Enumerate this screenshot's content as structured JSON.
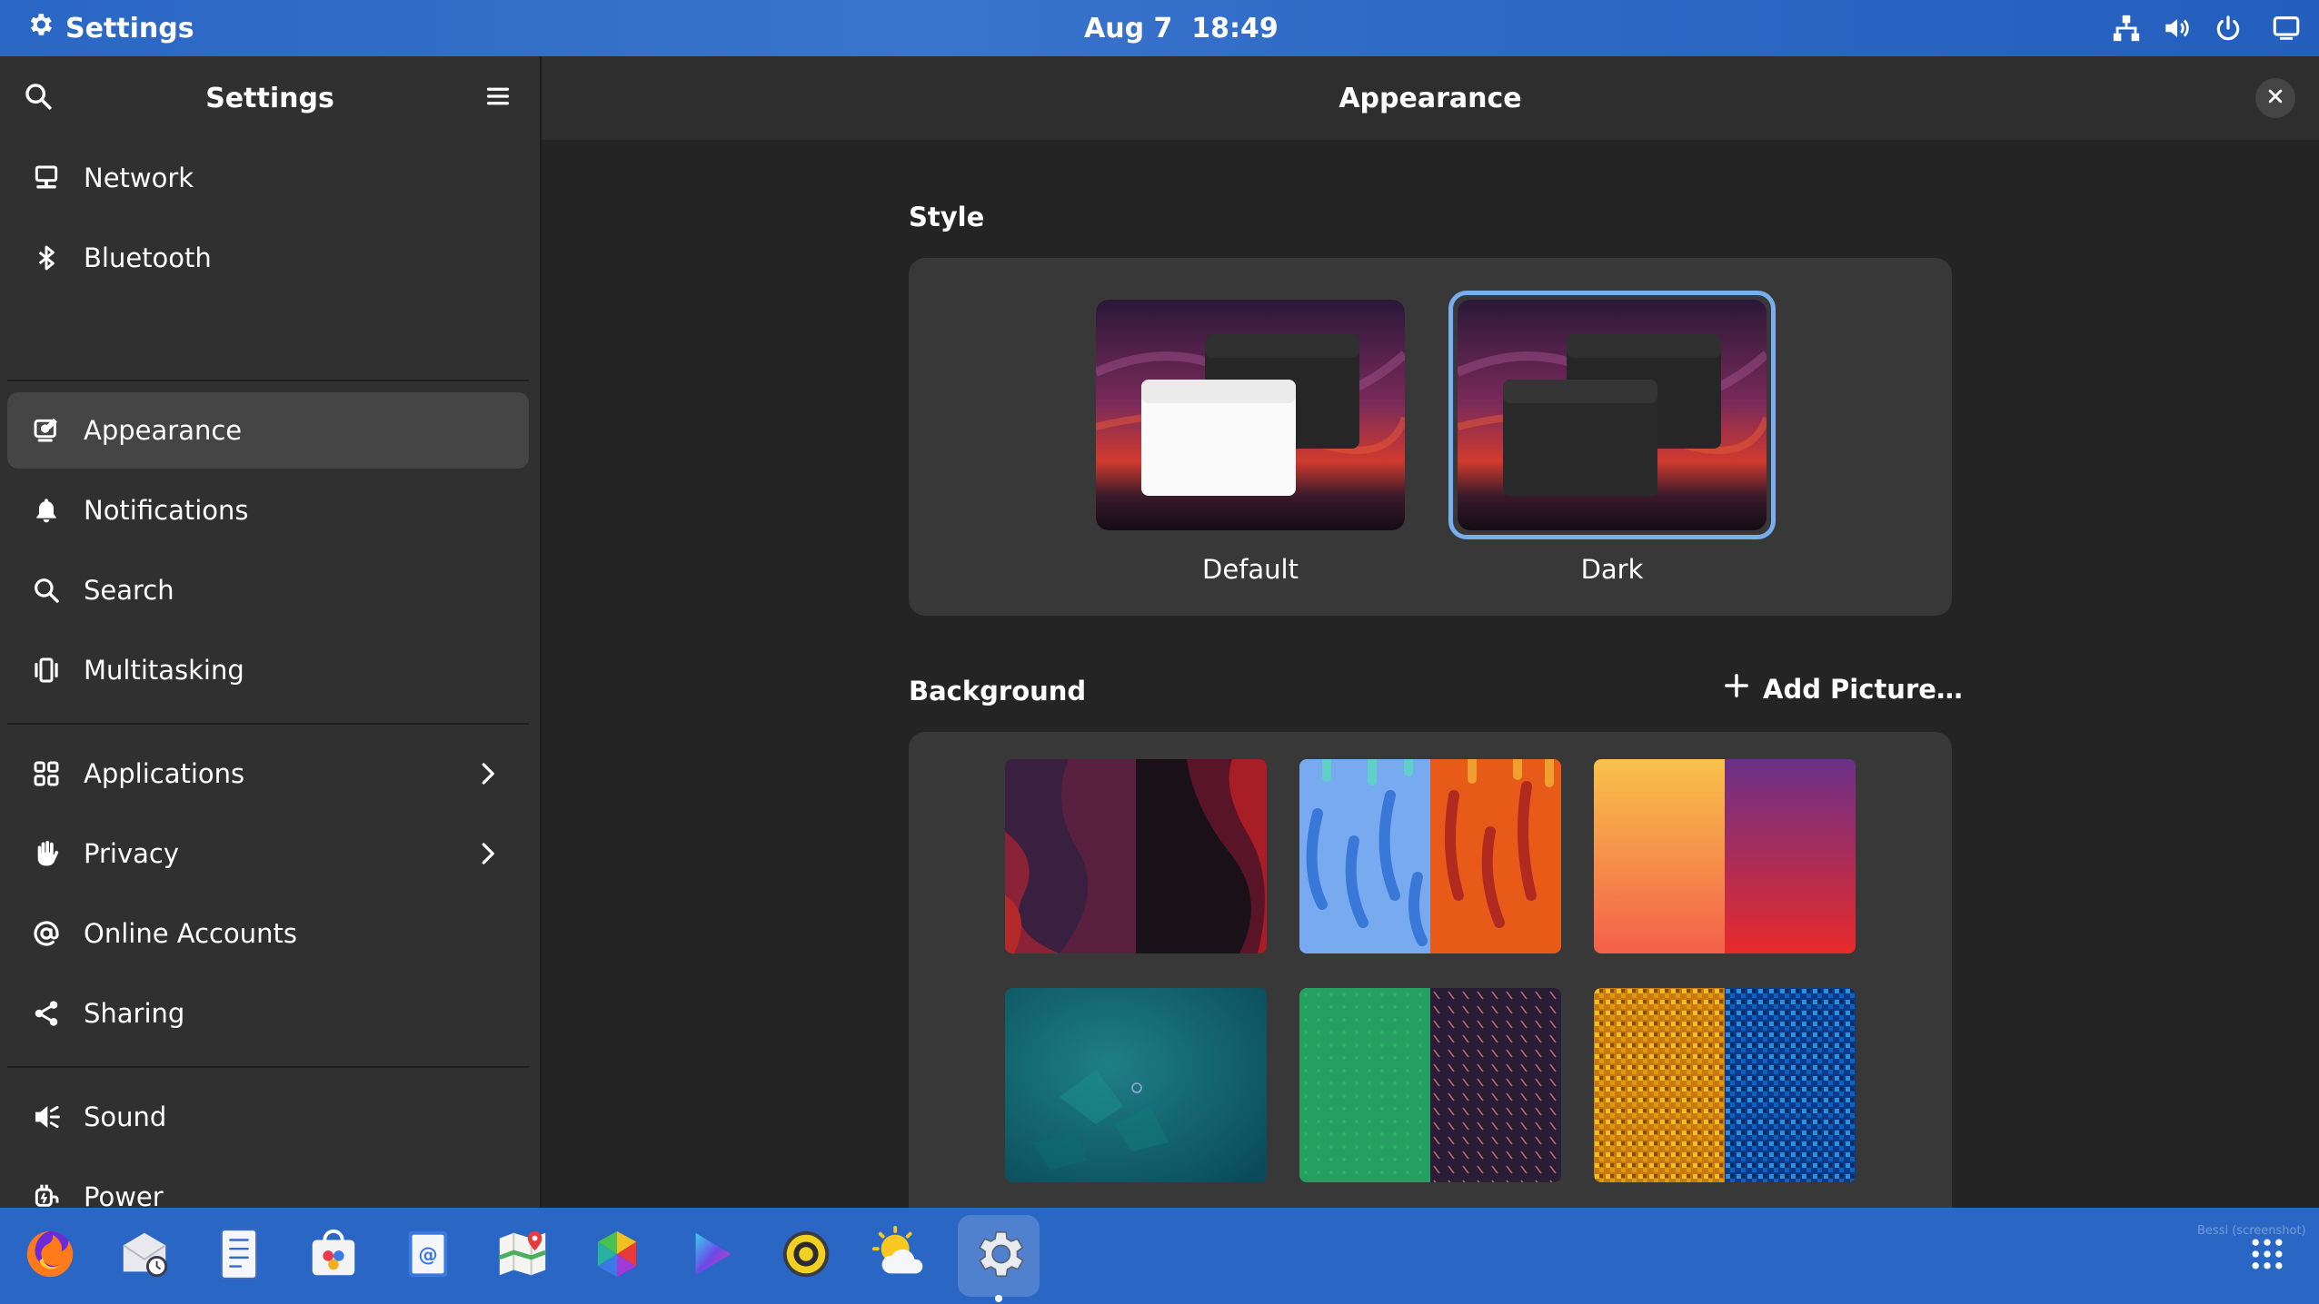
{
  "topbar": {
    "app_name": "Settings",
    "app_icon": "gear-icon",
    "clock": "Aug 7  18:49",
    "tray_icons": [
      "network-wired-icon",
      "volume-icon",
      "power-icon",
      "screen-icon"
    ]
  },
  "sidebar": {
    "title": "Settings",
    "search_icon": "search-icon",
    "menu_icon": "hamburger-menu-icon",
    "items": [
      {
        "label": "Network",
        "icon": "network-icon"
      },
      {
        "label": "Bluetooth",
        "icon": "bluetooth-icon"
      },
      {
        "label": "Appearance",
        "icon": "appearance-icon",
        "active": true
      },
      {
        "label": "Notifications",
        "icon": "bell-icon"
      },
      {
        "label": "Search",
        "icon": "search-icon"
      },
      {
        "label": "Multitasking",
        "icon": "multitasking-icon"
      },
      {
        "label": "Applications",
        "icon": "apps-grid-icon",
        "arrow": true
      },
      {
        "label": "Privacy",
        "icon": "hand-icon",
        "arrow": true
      },
      {
        "label": "Online Accounts",
        "icon": "at-icon"
      },
      {
        "label": "Sharing",
        "icon": "share-icon"
      },
      {
        "label": "Sound",
        "icon": "speaker-icon"
      },
      {
        "label": "Power",
        "icon": "power-plug-icon"
      }
    ]
  },
  "main": {
    "title": "Appearance",
    "close_icon": "close-icon",
    "style": {
      "heading": "Style",
      "options": [
        {
          "label": "Default",
          "selected": false
        },
        {
          "label": "Dark",
          "selected": true
        }
      ]
    },
    "background": {
      "heading": "Background",
      "add_label": "Add Picture…",
      "add_icon": "plus-icon",
      "wallpapers": [
        "wave-wallpaper",
        "drip-wallpaper",
        "gradient-wallpaper",
        "debian-wallpaper",
        "pattern-wallpaper",
        "mosaic-wallpaper"
      ]
    }
  },
  "dock": {
    "apps": [
      {
        "name": "Firefox",
        "icon": "firefox-icon"
      },
      {
        "name": "Evolution",
        "icon": "mail-clock-icon"
      },
      {
        "name": "Text Editor",
        "icon": "text-editor-icon"
      },
      {
        "name": "Software",
        "icon": "software-store-icon"
      },
      {
        "name": "Contacts",
        "icon": "contacts-icon"
      },
      {
        "name": "Maps",
        "icon": "maps-icon"
      },
      {
        "name": "Photos",
        "icon": "photos-icon"
      },
      {
        "name": "Videos",
        "icon": "videos-icon"
      },
      {
        "name": "Rhythmbox",
        "icon": "speaker-app-icon"
      },
      {
        "name": "Weather",
        "icon": "weather-icon"
      },
      {
        "name": "Settings",
        "icon": "settings-app-icon",
        "running": true
      }
    ],
    "show_apps_icon": "app-grid-icon",
    "watermark": "Bessi (screenshot)"
  },
  "colors": {
    "accent": "#78aeed",
    "topbar": "#2a66c4",
    "sidebar": "#303030",
    "main": "#242424",
    "card": "#383838"
  }
}
